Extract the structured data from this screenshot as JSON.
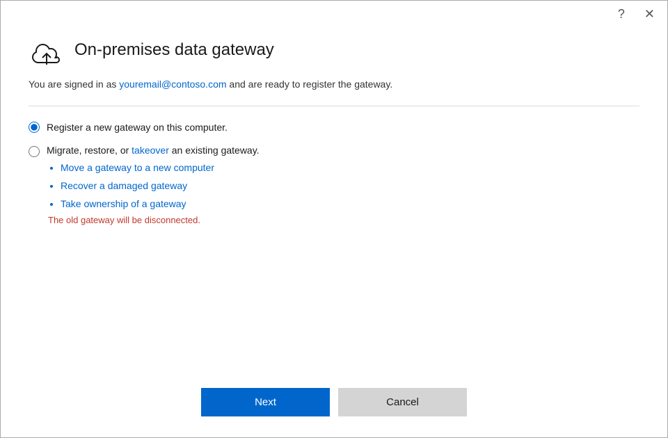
{
  "titlebar": {
    "help_icon": "?",
    "close_icon": "✕"
  },
  "header": {
    "title": "On-premises data gateway",
    "cloud_icon_label": "cloud-upload-icon"
  },
  "subtitle": {
    "prefix": "You are signed in as ",
    "email": "youremail@contoso.com",
    "suffix": " and are ready to register the gateway."
  },
  "options": {
    "option1": {
      "label": "Register a new gateway on this computer.",
      "selected": true
    },
    "option2": {
      "label_prefix": "Migrate, restore, or ",
      "label_link": "takeover",
      "label_suffix": " an existing gateway.",
      "selected": false,
      "bullets": [
        "Move a gateway to a new computer",
        "Recover a damaged gateway",
        "Take ownership of a gateway"
      ],
      "note": "The old gateway will be disconnected."
    }
  },
  "footer": {
    "next_label": "Next",
    "cancel_label": "Cancel"
  }
}
